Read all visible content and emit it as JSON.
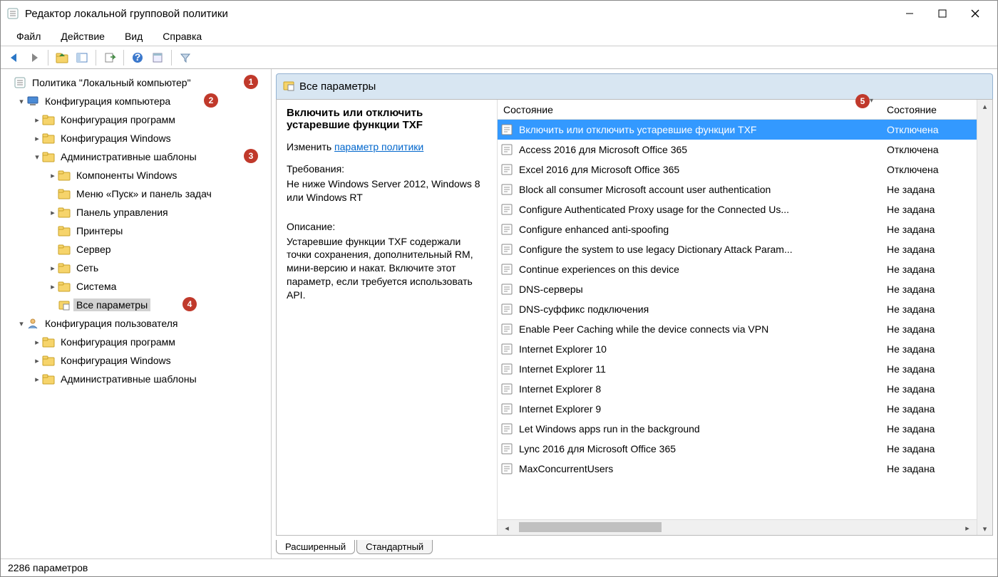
{
  "window": {
    "title": "Редактор локальной групповой политики"
  },
  "menu": {
    "file": "Файл",
    "action": "Действие",
    "view": "Вид",
    "help": "Справка"
  },
  "tree": {
    "root": "Политика \"Локальный компьютер\"",
    "computer_config": "Конфигурация компьютера",
    "cc_soft": "Конфигурация программ",
    "cc_win": "Конфигурация Windows",
    "cc_admin": "Административные шаблоны",
    "cc_admin_components": "Компоненты Windows",
    "cc_admin_startmenu": "Меню «Пуск» и панель задач",
    "cc_admin_cp": "Панель управления",
    "cc_admin_printers": "Принтеры",
    "cc_admin_server": "Сервер",
    "cc_admin_network": "Сеть",
    "cc_admin_system": "Система",
    "cc_admin_allsettings": "Все параметры",
    "user_config": "Конфигурация пользователя",
    "uc_soft": "Конфигурация программ",
    "uc_win": "Конфигурация Windows",
    "uc_admin": "Административные шаблоны"
  },
  "badges": {
    "b1": "1",
    "b2": "2",
    "b3": "3",
    "b4": "4",
    "b5": "5"
  },
  "panel": {
    "header": "Все параметры",
    "item_title": "Включить или отключить устаревшие функции TXF",
    "edit_label": "Изменить",
    "edit_link": "параметр политики",
    "req_title": "Требования:",
    "req_text": "Не ниже Windows Server 2012, Windows 8 или Windows RT",
    "desc_title": "Описание:",
    "desc_text": "Устаревшие функции TXF содержали точки сохранения, дополнительный RM, мини-версию и накат. Включите этот параметр, если требуется использовать API."
  },
  "list": {
    "col_name": "Состояние",
    "col_state": "Состояние",
    "rows": [
      {
        "name": "Включить или отключить устаревшие функции TXF",
        "state": "Отключена",
        "sel": true
      },
      {
        "name": "Access 2016 для Microsoft Office 365",
        "state": "Отключена"
      },
      {
        "name": "Excel 2016 для Microsoft Office 365",
        "state": "Отключена"
      },
      {
        "name": "Block all consumer Microsoft account user authentication",
        "state": "Не задана"
      },
      {
        "name": "Configure Authenticated Proxy usage for the Connected Us...",
        "state": "Не задана"
      },
      {
        "name": "Configure enhanced anti-spoofing",
        "state": "Не задана"
      },
      {
        "name": "Configure the system to use legacy Dictionary Attack Param...",
        "state": "Не задана"
      },
      {
        "name": "Continue experiences on this device",
        "state": "Не задана"
      },
      {
        "name": "DNS-серверы",
        "state": "Не задана"
      },
      {
        "name": "DNS-суффикс подключения",
        "state": "Не задана"
      },
      {
        "name": "Enable Peer Caching while the device connects via VPN",
        "state": "Не задана"
      },
      {
        "name": "Internet Explorer 10",
        "state": "Не задана"
      },
      {
        "name": "Internet Explorer 11",
        "state": "Не задана"
      },
      {
        "name": "Internet Explorer 8",
        "state": "Не задана"
      },
      {
        "name": "Internet Explorer 9",
        "state": "Не задана"
      },
      {
        "name": "Let Windows apps run in the background",
        "state": "Не задана"
      },
      {
        "name": "Lync 2016 для Microsoft Office 365",
        "state": "Не задана"
      },
      {
        "name": "MaxConcurrentUsers",
        "state": "Не задана"
      }
    ]
  },
  "tabs": {
    "extended": "Расширенный",
    "standard": "Стандартный"
  },
  "status": {
    "text": "2286 параметров"
  }
}
